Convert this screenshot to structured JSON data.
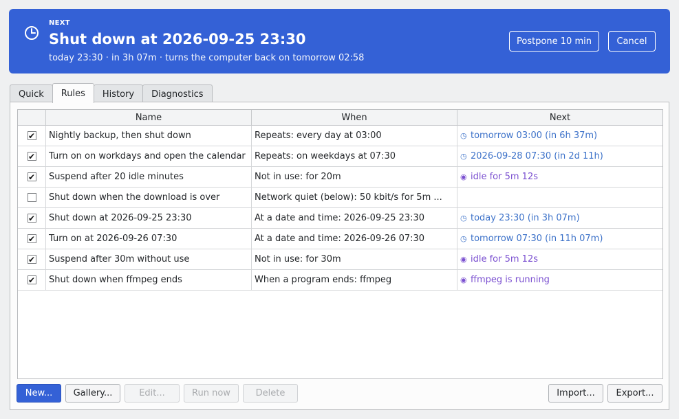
{
  "banner": {
    "icon": "clock-icon",
    "eyebrow": "NEXT",
    "title": "Shut down at 2026-09-25 23:30",
    "subtitle": "today 23:30 · in 3h 07m · turns the computer back on tomorrow 02:58",
    "postpone_label": "Postpone 10 min",
    "cancel_label": "Cancel",
    "color": "#3461d6"
  },
  "tabs": [
    {
      "label": "Quick",
      "active": false
    },
    {
      "label": "Rules",
      "active": true
    },
    {
      "label": "History",
      "active": false
    },
    {
      "label": "Diagnostics",
      "active": false
    }
  ],
  "table": {
    "columns": [
      "",
      "Name",
      "When",
      "Next"
    ],
    "rows": [
      {
        "enabled": true,
        "name": "Nightly backup, then shut down",
        "when": "Repeats: every day at 03:00",
        "next": "tomorrow 03:00 (in 6h 37m)",
        "next_kind": "time"
      },
      {
        "enabled": true,
        "name": "Turn on on workdays and open the calendar",
        "when": "Repeats: on weekdays at 07:30",
        "next": "2026-09-28 07:30 (in 2d 11h)",
        "next_kind": "time"
      },
      {
        "enabled": true,
        "name": "Suspend after 20 idle minutes",
        "when": "Not in use: for 20m",
        "next": "idle for 5m 12s",
        "next_kind": "idle"
      },
      {
        "enabled": false,
        "name": "Shut down when the download is over",
        "when": "Network quiet (below): 50 kbit/s for 5m ...",
        "next": "",
        "next_kind": "none"
      },
      {
        "enabled": true,
        "name": "Shut down at 2026-09-25 23:30",
        "when": "At a date and time: 2026-09-25 23:30",
        "next": "today 23:30 (in 3h 07m)",
        "next_kind": "time"
      },
      {
        "enabled": true,
        "name": "Turn on at 2026-09-26 07:30",
        "when": "At a date and time: 2026-09-26 07:30",
        "next": "tomorrow 07:30 (in 11h 07m)",
        "next_kind": "time"
      },
      {
        "enabled": true,
        "name": "Suspend after 30m without use",
        "when": "Not in use: for 30m",
        "next": "idle for 5m 12s",
        "next_kind": "idle"
      },
      {
        "enabled": true,
        "name": "Shut down when ffmpeg ends",
        "when": "When a program ends: ffmpeg",
        "next": "ffmpeg is running",
        "next_kind": "idle"
      }
    ]
  },
  "buttons": {
    "new": "New...",
    "gallery": "Gallery...",
    "edit": "Edit...",
    "run_now": "Run now",
    "delete": "Delete",
    "import": "Import...",
    "export": "Export..."
  },
  "colors": {
    "time_link": "#3d72c9",
    "idle_link": "#7a4fd0",
    "accent": "#3461d6"
  }
}
